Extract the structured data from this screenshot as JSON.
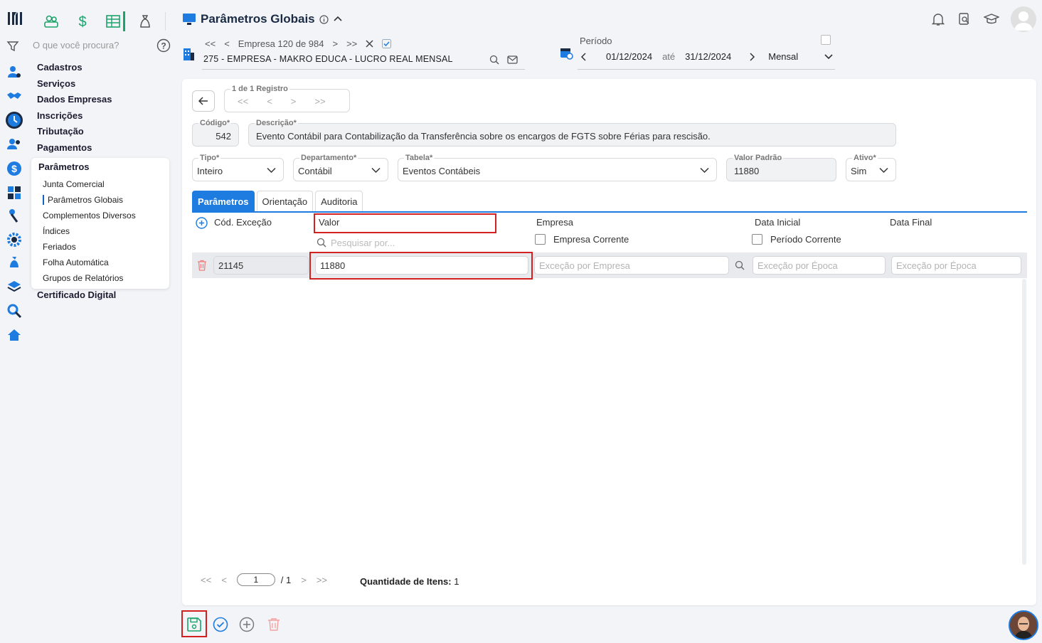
{
  "sidebar": {
    "search_placeholder": "O que você procura?",
    "menu": [
      "Cadastros",
      "Serviços",
      "Dados Empresas",
      "Inscrições",
      "Tributação",
      "Pagamentos"
    ],
    "submenu_title": "Parâmetros",
    "submenu": [
      "Junta Comercial",
      "Parâmetros Globais",
      "Complementos Diversos",
      "Índices",
      "Feriados",
      "Folha Automática",
      "Grupos de Relatórios"
    ],
    "menu_after": "Certificado Digital"
  },
  "header": {
    "title": "Parâmetros Globais",
    "empresa_nav": "Empresa 120 de 984",
    "empresa_name": "275 - EMPRESA - MAKRO EDUCA - LUCRO REAL MENSAL",
    "periodo_label": "Período",
    "date_from": "01/12/2024",
    "ate": "até",
    "date_to": "31/12/2024",
    "periodicity": "Mensal"
  },
  "record_nav": {
    "label": "1 de 1 Registro"
  },
  "form": {
    "codigo_label": "Código*",
    "codigo": "542",
    "descricao_label": "Descrição*",
    "descricao": "Evento Contábil para Contabilização da Transferência sobre os encargos de FGTS sobre Férias para rescisão.",
    "tipo_label": "Tipo*",
    "tipo": "Inteiro",
    "departamento_label": "Departamento*",
    "departamento": "Contábil",
    "tabela_label": "Tabela*",
    "tabela": "Eventos Contábeis",
    "valor_padrao_label": "Valor Padrão",
    "valor_padrao": "11880",
    "ativo_label": "Ativo*",
    "ativo": "Sim"
  },
  "tabs": [
    "Parâmetros",
    "Orientação",
    "Auditoria"
  ],
  "grid": {
    "col_cod": "Cód. Exceção",
    "col_valor": "Valor",
    "col_empresa": "Empresa",
    "col_data_inicial": "Data Inicial",
    "col_data_final": "Data Final",
    "search_placeholder": "Pesquisar por...",
    "empresa_corrente": "Empresa Corrente",
    "periodo_corrente": "Período Corrente",
    "row": {
      "cod": "21145",
      "valor": "11880",
      "empresa_placeholder": "Exceção por Empresa",
      "data_inicial_placeholder": "Exceção por Época",
      "data_final_placeholder": "Exceção por Época"
    }
  },
  "pager": {
    "page": "1",
    "total": "/ 1",
    "qtd_label": "Quantidade de Itens:",
    "qtd": "1"
  },
  "colors": {
    "primary": "#1e7be0",
    "highlight": "#d32020",
    "save": "#1ca36b",
    "delete": "#f08080"
  }
}
